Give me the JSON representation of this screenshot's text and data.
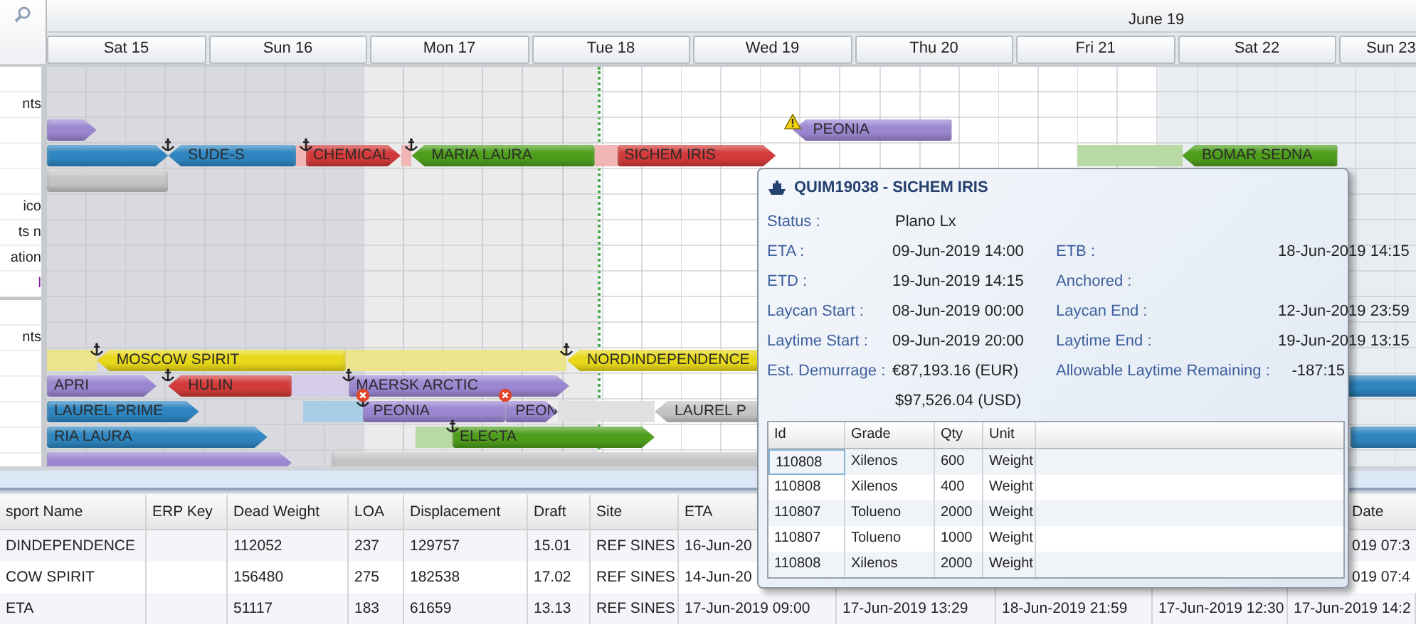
{
  "gantt": {
    "month_label": "June 19",
    "days": [
      {
        "label": "Sat 15",
        "weekend": true
      },
      {
        "label": "Sun 16",
        "weekend": true
      },
      {
        "label": "Mon 17",
        "weekend": false
      },
      {
        "label": "Tue 18",
        "weekend": false
      },
      {
        "label": "Wed 19",
        "weekend": false
      },
      {
        "label": "Thu 20",
        "weekend": false
      },
      {
        "label": "Fri 21",
        "weekend": false
      },
      {
        "label": "Sat 22",
        "weekend": true
      },
      {
        "label": "Sun 23",
        "weekend": true
      }
    ],
    "sections": [
      {
        "rows": [
          {},
          {
            "label": "nts"
          },
          {
            "bars": [
              {
                "color": "#9b86d0",
                "kind": "arrow-right"
              },
              {
                "label": "PEONIA",
                "color": "#9b86d0",
                "kind": "arrow-left",
                "markers": [
                  {
                    "kind": "warning"
                  }
                ]
              }
            ]
          },
          {
            "bars": [
              {
                "color": "#f0b5b5",
                "kind": "shade"
              },
              {
                "color": "#f0b5b5",
                "kind": "shade"
              },
              {
                "color": "#f0b5b5",
                "kind": "shade"
              },
              {
                "color": "#2f86c0",
                "kind": "arrow-right"
              },
              {
                "label": "SUDE-S",
                "color": "#2f86c0",
                "kind": "arrow-left",
                "markers": [
                  {
                    "kind": "anchor"
                  }
                ]
              },
              {
                "label": "CHEMICAL",
                "color": "#d23a3a",
                "kind": "arrow-right",
                "markers": [
                  {
                    "kind": "anchor"
                  }
                ]
              },
              {
                "label": "MARIA LAURA",
                "color": "#4e9e1c",
                "kind": "arrow-left",
                "markers": [
                  {
                    "kind": "anchor"
                  }
                ]
              },
              {
                "label": "SICHEM IRIS",
                "color": "#d23a3a",
                "kind": "arrow-right"
              },
              {
                "color": "#b8d9a4",
                "kind": "shade"
              },
              {
                "label": "BOMAR SEDNA",
                "color": "#4e9e1c",
                "kind": "arrow-left"
              }
            ]
          },
          {
            "bars": [
              {
                "color": "#c4c4c4",
                "kind": "plain"
              }
            ]
          },
          {
            "label": "ico"
          },
          {
            "label": "ts n"
          },
          {
            "label": "ation"
          },
          {
            "label": "l"
          }
        ]
      },
      {
        "rows": [
          {},
          {
            "label": "nts"
          },
          {
            "bars": [
              {
                "color": "#ece48c",
                "kind": "shade"
              },
              {
                "color": "#ece48c",
                "kind": "shade"
              },
              {
                "label": "MOSCOW SPIRIT",
                "color": "#e8d81a",
                "kind": "arrow-left",
                "markers": [
                  {
                    "kind": "anchor"
                  }
                ]
              },
              {
                "label": "NORDINDEPENDENCE",
                "color": "#e8d81a",
                "kind": "arrow-left",
                "markers": [
                  {
                    "kind": "anchor"
                  }
                ]
              }
            ]
          },
          {
            "bars": [
              {
                "label": "APRI",
                "color": "#9b86d0",
                "kind": "arrow-right"
              },
              {
                "label": "HULIN",
                "color": "#d23a3a",
                "kind": "arrow-left",
                "markers": [
                  {
                    "kind": "anchor"
                  }
                ]
              },
              {
                "color": "#d5cce8",
                "kind": "shade"
              },
              {
                "label": "MAERSK ARCTIC",
                "color": "#9b86d0",
                "kind": "arrow-right",
                "markers": [
                  {
                    "kind": "anchor"
                  }
                ]
              },
              {
                "color": "#2f86c0",
                "kind": "plain"
              }
            ]
          },
          {
            "bars": [
              {
                "label": "LAUREL PRIME",
                "color": "#2f86c0",
                "kind": "arrow-right"
              },
              {
                "color": "#a9cde6",
                "kind": "shade"
              },
              {
                "label": "PEONIA",
                "color": "#9b86d0",
                "kind": "plain",
                "markers": [
                  {
                    "kind": "anchor"
                  },
                  {
                    "kind": "error"
                  }
                ]
              },
              {
                "label": "PEON",
                "color": "#9b86d0",
                "kind": "arrow-right",
                "markers": [
                  {
                    "kind": "error"
                  }
                ]
              },
              {
                "color": "#e0e0e0",
                "kind": "shade"
              },
              {
                "label": "LAUREL P",
                "color": "#c4c4c4",
                "kind": "arrow-left"
              }
            ]
          },
          {
            "bars": [
              {
                "label": "RIA LAURA",
                "color": "#2f86c0",
                "kind": "arrow-right"
              },
              {
                "color": "#b8d9a4",
                "kind": "shade"
              },
              {
                "label": "ELECTA",
                "color": "#4e9e1c",
                "kind": "arrow-right",
                "markers": [
                  {
                    "kind": "anchor"
                  }
                ]
              },
              {
                "color": "#2f86c0",
                "kind": "plain"
              }
            ]
          },
          {
            "bars": [
              {
                "color": "#9b86d0",
                "kind": "arrow-right"
              },
              {
                "color": "#c4c4c4",
                "kind": "plain"
              }
            ]
          }
        ]
      }
    ]
  },
  "tooltip": {
    "title": "QUIM19038 - SICHEM IRIS",
    "status": {
      "label": "Status :",
      "value": "Plano Lx"
    },
    "fields": [
      {
        "label": "ETA :",
        "value": "09-Jun-2019 14:00"
      },
      {
        "label": "ETB :",
        "value": "18-Jun-2019 14:15"
      },
      {
        "label": "ETD :",
        "value": "19-Jun-2019 14:15"
      },
      {
        "label": "Anchored :"
      },
      {
        "label": "Laycan Start :",
        "value": "08-Jun-2019 00:00"
      },
      {
        "label": "Laycan End :",
        "value": "12-Jun-2019 23:59"
      },
      {
        "label": "Laytime Start :",
        "value": "09-Jun-2019 20:00"
      },
      {
        "label": "Laytime End :",
        "value": "19-Jun-2019 13:15"
      },
      {
        "label": "Est. Demurrage :",
        "value": "€87,193.16 (EUR)"
      },
      {
        "label": "Allowable Laytime Remaining :",
        "value": "-187:15"
      }
    ],
    "demurrage_usd": "$97,526.04 (USD)",
    "grid": {
      "columns": [
        "Id",
        "Grade",
        "Qty",
        "Unit"
      ],
      "rows": [
        {
          "cells": [
            "110808",
            "Xilenos",
            "600",
            "Weight"
          ],
          "selected": true
        },
        {
          "cells": [
            "110808",
            "Xilenos",
            "400",
            "Weight"
          ],
          "selected": false
        },
        {
          "cells": [
            "110807",
            "Tolueno",
            "2000",
            "Weight"
          ],
          "selected": false
        },
        {
          "cells": [
            "110807",
            "Tolueno",
            "1000",
            "Weight"
          ],
          "selected": false
        },
        {
          "cells": [
            "110808",
            "Xilenos",
            "2000",
            "Weight"
          ],
          "selected": false
        }
      ]
    }
  },
  "table": {
    "columns": [
      "sport Name",
      "ERP Key",
      "Dead Weight",
      "LOA",
      "Displacement",
      "Draft",
      "Site",
      "ETA",
      "Date"
    ],
    "rows": [
      {
        "cells": [
          "DINDEPENDENCE",
          "",
          "112052",
          "237",
          "129757",
          "15.01",
          "REF SINES",
          "16-Jun-20",
          "019 07:3"
        ]
      },
      {
        "cells": [
          "COW SPIRIT",
          "",
          "156480",
          "275",
          "182538",
          "17.02",
          "REF SINES",
          "14-Jun-20",
          "019 07:4"
        ]
      },
      {
        "cells": [
          "ETA",
          "",
          "51117",
          "183",
          "61659",
          "13.13",
          "REF SINES",
          "17-Jun-2019 09:00",
          "17-Jun-2019 13:29",
          "18-Jun-2019 21:59",
          "17-Jun-2019 12:30",
          "17-Jun-2019 14:2"
        ]
      }
    ]
  }
}
